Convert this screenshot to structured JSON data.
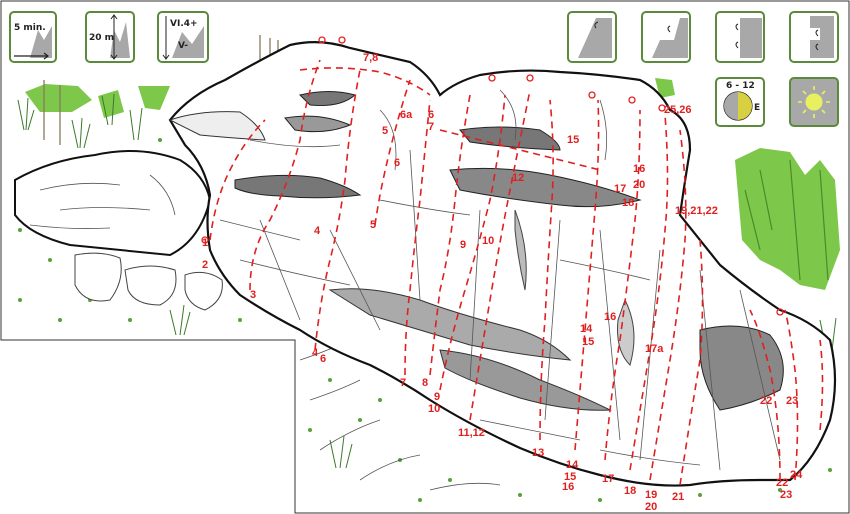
{
  "info": {
    "approach": "5 min.",
    "height": "20 m",
    "grade_top": "VI.4+",
    "grade_bottom": "V-",
    "sun_hours": "6 - 12",
    "aspect": "E"
  },
  "colors": {
    "route": "#e02020",
    "vegetation": "#7dc84a",
    "icon_fill": "#a8a8a8",
    "icon_border": "#5a8a3a"
  },
  "icons": [
    "walk-time-icon",
    "height-icon",
    "grade-range-icon",
    "slab-icon",
    "overhang-icon",
    "vertical-wall-icon",
    "roof-icon",
    "sun-hours-icon",
    "sunny-icon"
  ],
  "route_labels": [
    {
      "id": "r1",
      "text": "1"
    },
    {
      "id": "r2",
      "text": "2"
    },
    {
      "id": "r3",
      "text": "3"
    },
    {
      "id": "r4",
      "text": "4"
    },
    {
      "id": "r4b",
      "text": "4"
    },
    {
      "id": "r5",
      "text": "5"
    },
    {
      "id": "r5b",
      "text": "5"
    },
    {
      "id": "r6",
      "text": "6"
    },
    {
      "id": "r6b",
      "text": "6"
    },
    {
      "id": "r6c",
      "text": "6"
    },
    {
      "id": "r6a",
      "text": "6a"
    },
    {
      "id": "r7",
      "text": "7"
    },
    {
      "id": "r7b",
      "text": "7"
    },
    {
      "id": "r78",
      "text": "7,8"
    },
    {
      "id": "r8",
      "text": "8"
    },
    {
      "id": "r9",
      "text": "9"
    },
    {
      "id": "r9b",
      "text": "9"
    },
    {
      "id": "r10",
      "text": "10"
    },
    {
      "id": "r10b",
      "text": "10"
    },
    {
      "id": "r1112",
      "text": "11,12"
    },
    {
      "id": "r12",
      "text": "12"
    },
    {
      "id": "r13",
      "text": "13"
    },
    {
      "id": "r14",
      "text": "14"
    },
    {
      "id": "r14b",
      "text": "14"
    },
    {
      "id": "r15",
      "text": "15"
    },
    {
      "id": "r15b",
      "text": "15"
    },
    {
      "id": "r15c",
      "text": "15"
    },
    {
      "id": "r16",
      "text": "16"
    },
    {
      "id": "r16b",
      "text": "16"
    },
    {
      "id": "r16c",
      "text": "16"
    },
    {
      "id": "r17",
      "text": "17"
    },
    {
      "id": "r17b",
      "text": "17"
    },
    {
      "id": "r17a",
      "text": "17a"
    },
    {
      "id": "r18",
      "text": "18"
    },
    {
      "id": "r18b",
      "text": "18"
    },
    {
      "id": "r19",
      "text": "19"
    },
    {
      "id": "r20",
      "text": "20"
    },
    {
      "id": "r20b",
      "text": "20"
    },
    {
      "id": "r19212",
      "text": "19,21,22"
    },
    {
      "id": "r21",
      "text": "21"
    },
    {
      "id": "r22",
      "text": "22"
    },
    {
      "id": "r22b",
      "text": "22"
    },
    {
      "id": "r23",
      "text": "23"
    },
    {
      "id": "r23b",
      "text": "23"
    },
    {
      "id": "r24",
      "text": "24"
    },
    {
      "id": "r2526",
      "text": "25,26"
    }
  ]
}
